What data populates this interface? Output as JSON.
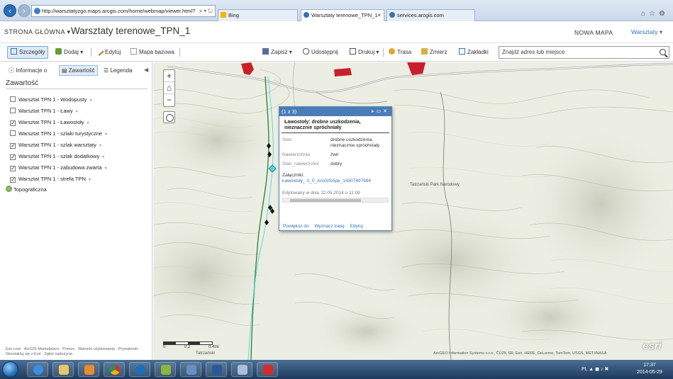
{
  "browser": {
    "url": "http://warsztatyzgo.maps.arcgis.com/home/webmap/viewer.html?",
    "tabs": [
      {
        "label": "Bing",
        "active": false
      },
      {
        "label": "Warsztaty terenowe_TPN_1",
        "active": true
      },
      {
        "label": "services.arcgis.com",
        "active": false
      }
    ]
  },
  "header": {
    "home": "STRONA GŁÓWNA",
    "title": "Warsztaty terenowe_TPN_1",
    "new_map": "NOWA MAPA",
    "user": "Warsztaty"
  },
  "toolbar": {
    "details": "Szczegóły",
    "add": "Dodaj",
    "edit": "Edytuj",
    "basemap": "Mapa bazowa",
    "save": "Zapisz",
    "share": "Udostępnij",
    "print": "Drukuj",
    "route": "Trasa",
    "measure": "Zmierz",
    "bookmarks": "Zakładki",
    "search_placeholder": "Znajdź adres lub miejsce"
  },
  "left_panel": {
    "tabs": {
      "info": "Informacje o",
      "content": "Zawartość",
      "legend": "Legenda"
    },
    "heading": "Zawartość",
    "layers": [
      {
        "label": "Warsztat TPN 1 - Wodopusty",
        "checked": false
      },
      {
        "label": "Warsztat TPN 1 - Ławy",
        "checked": false
      },
      {
        "label": "Warsztat TPN 1 - Ławostoły",
        "checked": true
      },
      {
        "label": "Warsztat TPN 1 - szlaki turystyczne",
        "checked": false
      },
      {
        "label": "Warsztat TPN 1 - szlak warsztaty",
        "checked": true
      },
      {
        "label": "Warsztat TPN 1 - szlak dodatkowy",
        "checked": true
      },
      {
        "label": "Warsztat TPN 1 - zabudowa zwarta",
        "checked": true
      },
      {
        "label": "Warsztat TPN 1 - strefa TPN",
        "checked": true
      }
    ],
    "basemap": "Topograficzna",
    "footer": "Esri.com · ArcGIS Marketplace · Pomoc · Warunki użytkowania · Prywatność · Skontaktuj się z Esri · Zgłoś nadużycie"
  },
  "map": {
    "zoom_in": "+",
    "zoom_out": "−",
    "scale": [
      "0",
      "0.2",
      "0.4mi"
    ],
    "attribution": "ArcGEO Information Systems s.r.o., ČÚZK SR, Esri, HERE, DeLorme, TomTom, USGS, METI/NASA",
    "esri": "esri",
    "place_label": "Tatrzański",
    "place_label_2": "Tatrzański Park Narodowy"
  },
  "popup": {
    "counter": "(1 z 3)",
    "title": "Ławostoły: drobne uszkodzenia, nieznacznie spróchniały",
    "fields": [
      {
        "key": "Stan",
        "value": "drobne uszkodzenia, nieznacznie spróchniały"
      },
      {
        "key": "Nawierzchnia",
        "value": "żwir"
      },
      {
        "key": "Stan_nawierzchni",
        "value": "dobry"
      }
    ],
    "attachments_label": "Załączniki:",
    "attachment": "Ławostoły_-1_0_ArcGISApp_14307497694",
    "edited": "Edytowany w dniu 22.05.2014 o 11:09",
    "actions": {
      "zoom": "Powiększ do",
      "route": "Wyznacz trasę",
      "edit": "Edytuj"
    }
  },
  "taskbar": {
    "language": "PL",
    "time": "17:37",
    "date": "2014-05-29"
  },
  "colors": {
    "accent": "#2e6fb5",
    "popup_header": "#4a7db8",
    "trail_green": "#2f8a3c",
    "trail_cyan": "#4fd2e6",
    "settlement_red": "#c8202a"
  }
}
